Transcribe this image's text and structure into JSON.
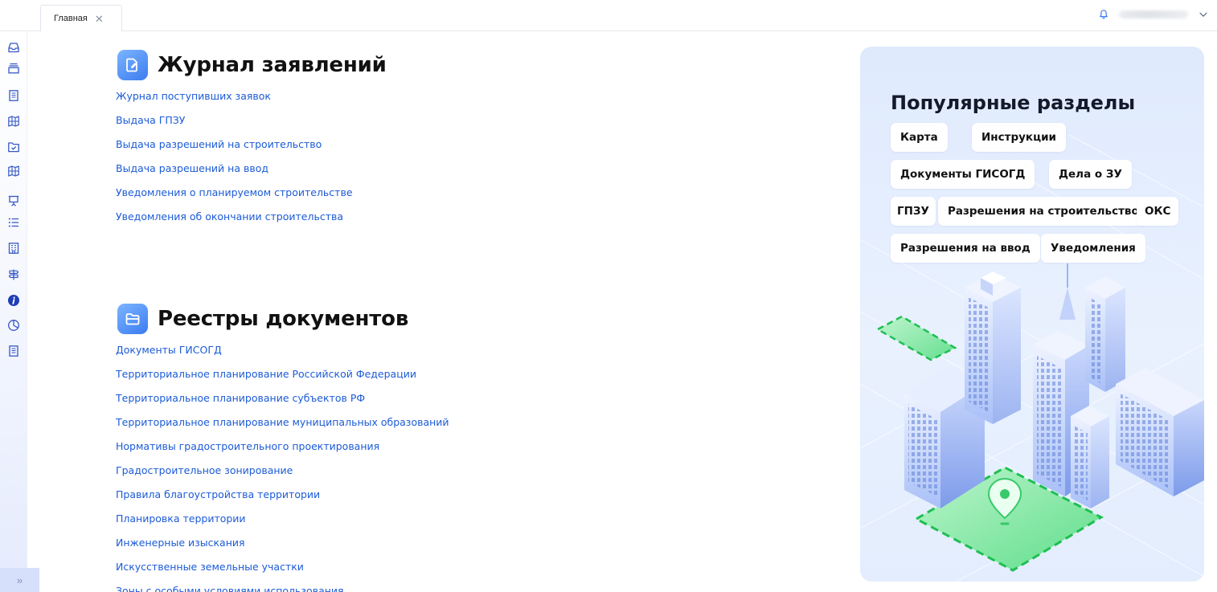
{
  "tabs": [
    {
      "label": "Главная",
      "close_icon": "close-icon"
    }
  ],
  "header": {
    "bell_icon": "bell-icon",
    "user_menu_icon": "chevron-down-icon"
  },
  "sidebar": {
    "items": [
      {
        "icon": "inbox-icon"
      },
      {
        "icon": "archive-icon"
      },
      {
        "icon": "document-icon"
      },
      {
        "icon": "map-icon"
      },
      {
        "icon": "folder-check-icon"
      },
      {
        "icon": "map-icon"
      },
      {
        "icon": "presentation-icon"
      },
      {
        "icon": "list-icon"
      },
      {
        "icon": "building-icon"
      },
      {
        "icon": "signpost-icon"
      },
      {
        "icon": "info-icon"
      },
      {
        "icon": "pie-chart-icon"
      },
      {
        "icon": "document-icon"
      }
    ],
    "expand_label": "»"
  },
  "applications": {
    "title": "Журнал заявлений",
    "icon": "edit-document-icon",
    "links": [
      "Журнал поступивших заявок",
      "Выдача ГПЗУ",
      "Выдача разрешений на строительство",
      "Выдача разрешений на ввод",
      "Уведомления о планируемом строительстве",
      "Уведомления об окончании строительства"
    ]
  },
  "registries": {
    "title": "Реестры документов",
    "icon": "folder-icon",
    "links": [
      "Документы ГИСОГД",
      "Территориальное планирование Российской Федерации",
      "Территориальное планирование субъектов РФ",
      "Территориальное планирование муниципальных образований",
      "Нормативы градостроительного проектирования",
      "Градостроительное зонирование",
      "Правила благоустройства территории",
      "Планировка территории",
      "Инженерные изыскания",
      "Искусственные земельные участки",
      "Зоны с особыми условиями использования"
    ]
  },
  "popular": {
    "title": "Популярные разделы",
    "chips": [
      "Карта",
      "Инструкции",
      "Документы ГИСОГД",
      "Дела о ЗУ",
      "ГПЗУ",
      "Разрешения на строительство",
      "ОКС",
      "Разрешения на ввод",
      "Уведомления"
    ],
    "illustration_icon": "city-illustration"
  },
  "colors": {
    "link": "#1c5bd6",
    "accent": "#3c7cf0",
    "panel_bg": "#e4eefd",
    "green_plot": "#5fe08a"
  }
}
